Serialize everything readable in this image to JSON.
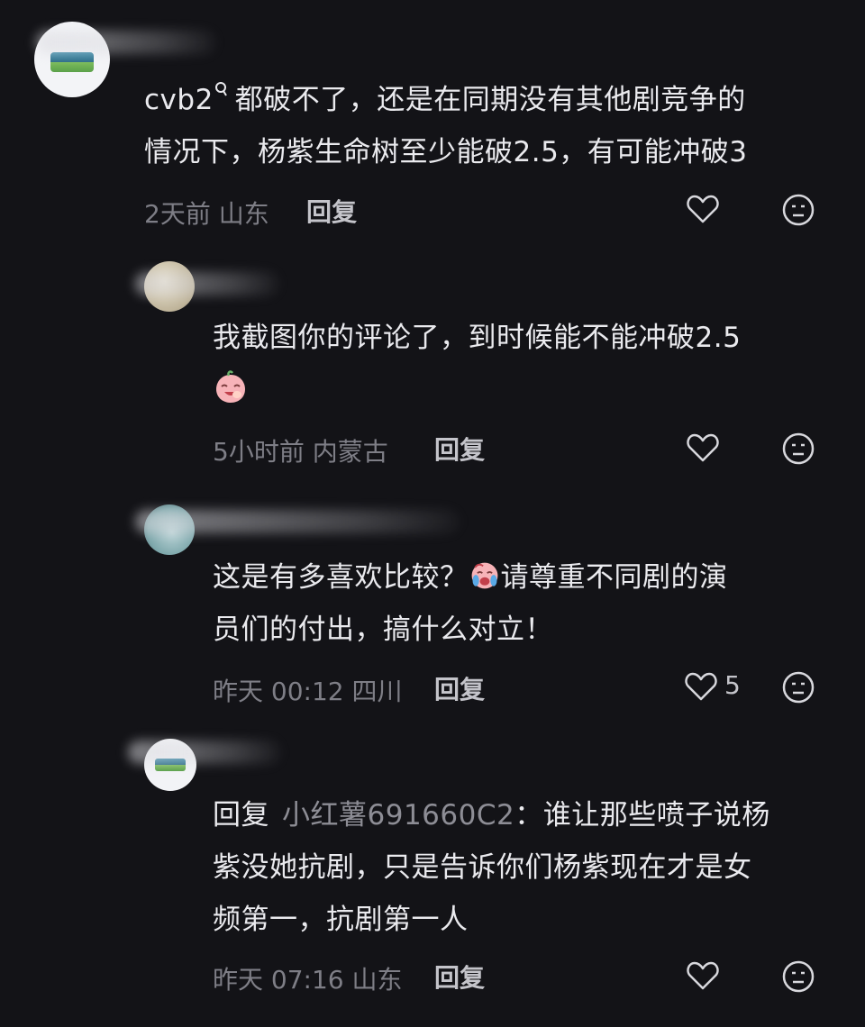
{
  "comments": [
    {
      "username_prefix": "cvb2",
      "username_suffix_icon": "dot-icon",
      "text_line1": "都破不了，还是在同期没有其他剧竞争的",
      "text_line2": "情况下，杨紫生命树至少能破2.5，有可能冲破3",
      "time": "2天前 山东",
      "reply_label": "回复"
    },
    {
      "text_line1": "我截图你的评论了，到时候能不能冲破2.5",
      "emoji": "laughing-peach-emoji",
      "time": "5小时前 内蒙古",
      "reply_label": "回复"
    },
    {
      "text_line1_part1": "这是有多喜欢比较？",
      "emoji": "crying-face-emoji",
      "text_line1_part2": "请尊重不同剧的演",
      "text_line2": "员们的付出，搞什么对立！",
      "time": "昨天 00:12 四川",
      "reply_label": "回复",
      "like_count": "5"
    },
    {
      "reply_prefix": "回复",
      "reply_target": "小红薯691660C2",
      "text_line1_rest": "：谁让那些喷子说杨",
      "text_line2": "紫没她抗剧，只是告诉你们杨紫现在才是女",
      "text_line3": "频第一，抗剧第一人",
      "time": "昨天 07:16 山东",
      "reply_label": "回复"
    }
  ],
  "colors": {
    "background": "#131317",
    "text": "#eaeaee",
    "meta": "#7e7e86"
  }
}
